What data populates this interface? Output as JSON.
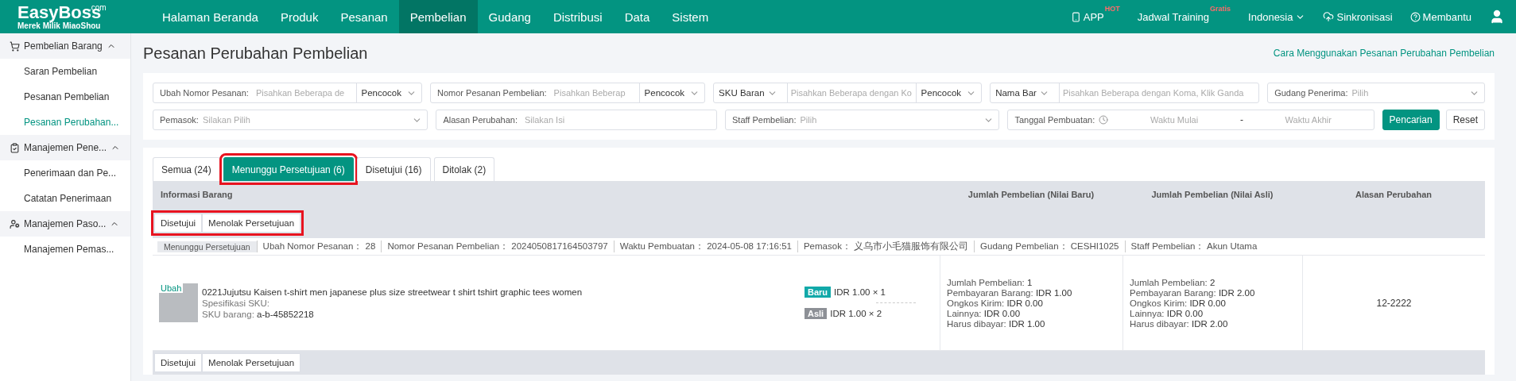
{
  "brand": {
    "name": "EasyBoss",
    "superscript": ".com",
    "tagline": "Merek Milik MiaoShou"
  },
  "nav": [
    {
      "label": "Halaman Beranda",
      "selected": false
    },
    {
      "label": "Produk",
      "selected": false
    },
    {
      "label": "Pesanan",
      "selected": false
    },
    {
      "label": "Pembelian",
      "selected": true
    },
    {
      "label": "Gudang",
      "selected": false
    },
    {
      "label": "Distribusi",
      "selected": false
    },
    {
      "label": "Data",
      "selected": false
    },
    {
      "label": "Sistem",
      "selected": false
    }
  ],
  "top_right": [
    {
      "kind": "app",
      "label": "APP",
      "badge": "HOT"
    },
    {
      "kind": "plain",
      "label": "Jadwal Training",
      "badge": "Gratis"
    },
    {
      "kind": "dropdown",
      "label": "Indonesia"
    },
    {
      "kind": "sync",
      "label": "Sinkronisasi"
    },
    {
      "kind": "help",
      "label": "Membantu"
    },
    {
      "kind": "user"
    }
  ],
  "sidebar": [
    {
      "label": "Pembelian Barang",
      "expanded": true,
      "items": [
        {
          "label": "Saran Pembelian",
          "selected": false
        },
        {
          "label": "Pesanan Pembelian",
          "selected": false
        },
        {
          "label": "Pesanan Perubahan...",
          "selected": true
        }
      ]
    },
    {
      "label": "Manajemen Pene...",
      "expanded": true,
      "items": [
        {
          "label": "Penerimaan dan Pe...",
          "selected": false
        },
        {
          "label": "Catatan Penerimaan",
          "selected": false
        }
      ]
    },
    {
      "label": "Manajemen Paso...",
      "expanded": true,
      "items": [
        {
          "label": "Manajemen Pemas...",
          "selected": false
        }
      ]
    }
  ],
  "page": {
    "title": "Pesanan Perubahan Pembelian",
    "help_link": "Cara Menggunakan Pesanan Perubahan Pembelian"
  },
  "filters": [
    [
      {
        "kind": "text-match",
        "label": "Ubah Nomor Pesanan:",
        "placeholder": "Pisahkan Beberapa de",
        "match": "Pencocok"
      },
      {
        "kind": "text-match",
        "label": "Nomor Pesanan Pembelian:",
        "placeholder": "Pisahkan Beberap",
        "match": "Pencocok"
      },
      {
        "kind": "dropdown-text-match",
        "label": "SKU Baran",
        "placeholder": "Pisahkan Beberapa dengan Ko",
        "match": "Pencocok"
      },
      {
        "kind": "dropdown-text",
        "label": "Nama Bar",
        "placeholder": "Pisahkan Beberapa dengan Koma, Klik Ganda"
      },
      {
        "kind": "select",
        "label": "Gudang Penerima:",
        "placeholder": "Pilih"
      }
    ],
    [
      {
        "kind": "select",
        "label": "Pemasok:",
        "placeholder": "Silakan Pilih"
      },
      {
        "kind": "text",
        "label": "Alasan Perubahan:",
        "placeholder": "Silakan Isi"
      },
      {
        "kind": "select",
        "label": "Staff Pembelian:",
        "placeholder": "Pilih"
      },
      {
        "kind": "date-range",
        "label": "Tanggal Pembuatan:",
        "start": "Waktu Mulai",
        "separator": "-",
        "end": "Waktu Akhir"
      }
    ]
  ],
  "filter_buttons": [
    {
      "label": "Pencarian",
      "kind": "primary"
    },
    {
      "label": "Reset",
      "kind": "default"
    }
  ],
  "tabs": [
    {
      "label": "Semua (24)",
      "selected": false,
      "highlighted": false
    },
    {
      "label": "Menunggu Persetujuan (6)",
      "selected": true,
      "highlighted": true
    },
    {
      "label": "Disetujui (16)",
      "selected": false,
      "highlighted": false
    },
    {
      "label": "Ditolak (2)",
      "selected": false,
      "highlighted": false
    }
  ],
  "table": {
    "columns": [
      "Informasi Barang",
      "Jumlah Pembelian (Nilai Baru)",
      "Jumlah Pembelian (Nilai Asli)",
      "Alasan Perubahan"
    ],
    "action_bar": {
      "highlighted": true,
      "buttons": [
        "Disetujui",
        "Menolak Persetujuan"
      ]
    },
    "orders": [
      {
        "status": "Menunggu Persetujuan",
        "fields": [
          {
            "label": "Ubah Nomor Pesanan：",
            "value": "28"
          },
          {
            "label": "Nomor Pesanan Pembelian：",
            "value": "2024050817164503797"
          },
          {
            "label": "Waktu Pembuatan：",
            "value": "2024-05-08 17:16:51"
          },
          {
            "label": "Pemasok：",
            "value": "义乌市小毛猫服饰有限公司"
          },
          {
            "label": "Gudang Pembelian：",
            "value": "CESHI1025"
          },
          {
            "label": "Staff Pembelian：",
            "value": "Akun Utama"
          }
        ],
        "product": {
          "badge": "Ubah",
          "title": "0221Jujutsu Kaisen t-shirt men japanese plus size streetwear t shirt tshirt graphic tees women",
          "spec_label": "Spesifikasi SKU:",
          "sku_label": "SKU barang:",
          "sku": "a-b-45852218"
        },
        "prices": [
          {
            "kind": "new",
            "tag": "Baru",
            "text": "IDR 1.00 × 1"
          },
          {
            "kind": "old",
            "tag": "Asli",
            "text": "IDR 1.00 × 2"
          }
        ],
        "new_values": [
          {
            "label": "Jumlah Pembelian:",
            "value": "1"
          },
          {
            "label": "Pembayaran Barang:",
            "value": "IDR 1.00"
          },
          {
            "label": "Ongkos Kirim:",
            "value": "IDR 0.00"
          },
          {
            "label": "Lainnya:",
            "value": "IDR 0.00"
          },
          {
            "label": "Harus dibayar:",
            "value": "IDR 1.00"
          }
        ],
        "old_values": [
          {
            "label": "Jumlah Pembelian:",
            "value": "2"
          },
          {
            "label": "Pembayaran Barang:",
            "value": "IDR 2.00"
          },
          {
            "label": "Ongkos Kirim:",
            "value": "IDR 0.00"
          },
          {
            "label": "Lainnya:",
            "value": "IDR 0.00"
          },
          {
            "label": "Harus dibayar:",
            "value": "IDR 2.00"
          }
        ],
        "reason": "12-2222"
      }
    ],
    "bottom_action_bar": {
      "buttons": [
        "Disetujui",
        "Menolak Persetujuan"
      ]
    }
  }
}
